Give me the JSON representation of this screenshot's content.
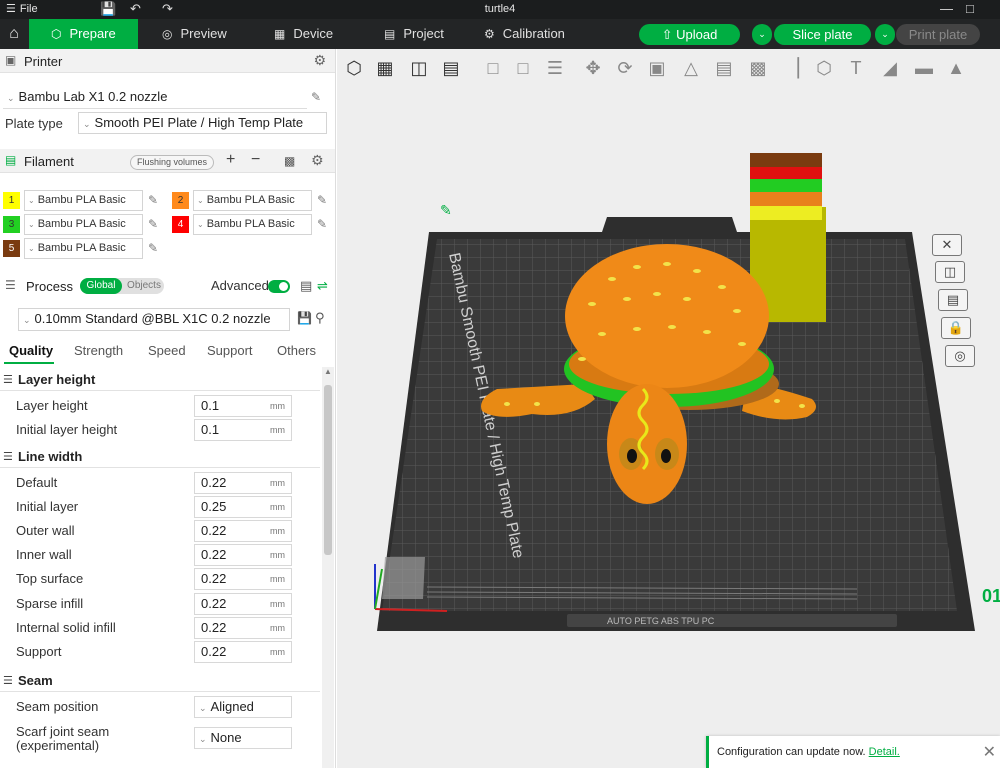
{
  "window": {
    "title": "turtle4",
    "menu_label": "File"
  },
  "nav": {
    "tabs": [
      {
        "label": "Prepare",
        "icon": "cube-icon"
      },
      {
        "label": "Preview",
        "icon": "eye-icon"
      },
      {
        "label": "Device",
        "icon": "device-icon"
      },
      {
        "label": "Project",
        "icon": "project-icon"
      },
      {
        "label": "Calibration",
        "icon": "calibration-icon"
      }
    ],
    "upload_label": "Upload",
    "slice_label": "Slice plate",
    "print_label": "Print plate",
    "colors": {
      "accent": "#00ae42",
      "nav_bg": "#232526",
      "titlebar_bg": "#1b1d1e"
    }
  },
  "printer": {
    "section_label": "Printer",
    "name": "Bambu Lab X1 0.2 nozzle",
    "plate_type_label": "Plate type",
    "plate_type": "Smooth PEI Plate / High Temp Plate"
  },
  "filament": {
    "section_label": "Filament",
    "flushing_label": "Flushing volumes",
    "slots": [
      {
        "num": "1",
        "color": "#ffff00",
        "name": "Bambu PLA Basic"
      },
      {
        "num": "2",
        "color": "#ff8a1c",
        "name": "Bambu PLA Basic"
      },
      {
        "num": "3",
        "color": "#22d022",
        "name": "Bambu PLA Basic"
      },
      {
        "num": "4",
        "color": "#ff0000",
        "name": "Bambu PLA Basic"
      },
      {
        "num": "5",
        "color": "#7a3b10",
        "name": "Bambu PLA Basic"
      }
    ]
  },
  "process": {
    "section_label": "Process",
    "global_label": "Global",
    "objects_label": "Objects",
    "advanced_label": "Advanced",
    "preset": "0.10mm Standard @BBL X1C 0.2 nozzle",
    "tabs": [
      "Quality",
      "Strength",
      "Speed",
      "Support",
      "Others"
    ]
  },
  "quality": {
    "layer_height_group": "Layer height",
    "layer_height_label": "Layer height",
    "layer_height": "0.1",
    "initial_layer_height_label": "Initial layer height",
    "initial_layer_height": "0.1",
    "line_width_group": "Line width",
    "default_label": "Default",
    "default": "0.22",
    "initial_layer_label": "Initial layer",
    "initial_layer": "0.25",
    "outer_wall_label": "Outer wall",
    "outer_wall": "0.22",
    "inner_wall_label": "Inner wall",
    "inner_wall": "0.22",
    "top_surface_label": "Top surface",
    "top_surface": "0.22",
    "sparse_infill_label": "Sparse infill",
    "sparse_infill": "0.22",
    "internal_solid_infill_label": "Internal solid infill",
    "internal_solid_infill": "0.22",
    "support_label": "Support",
    "support": "0.22",
    "unit": "mm",
    "seam_group": "Seam",
    "seam_position_label": "Seam position",
    "seam_position": "Aligned",
    "scarf_label_1": "Scarf joint seam",
    "scarf_label_2": "(experimental)",
    "scarf_value": "None"
  },
  "viewport": {
    "plate_label": "Bambu Smooth PEI Plate / High Temp Plate",
    "plate_code": "AUTO PETG ABS TPU PC",
    "axis_label": "01"
  },
  "notification": {
    "message": "Configuration can update now.",
    "link": "Detail."
  }
}
